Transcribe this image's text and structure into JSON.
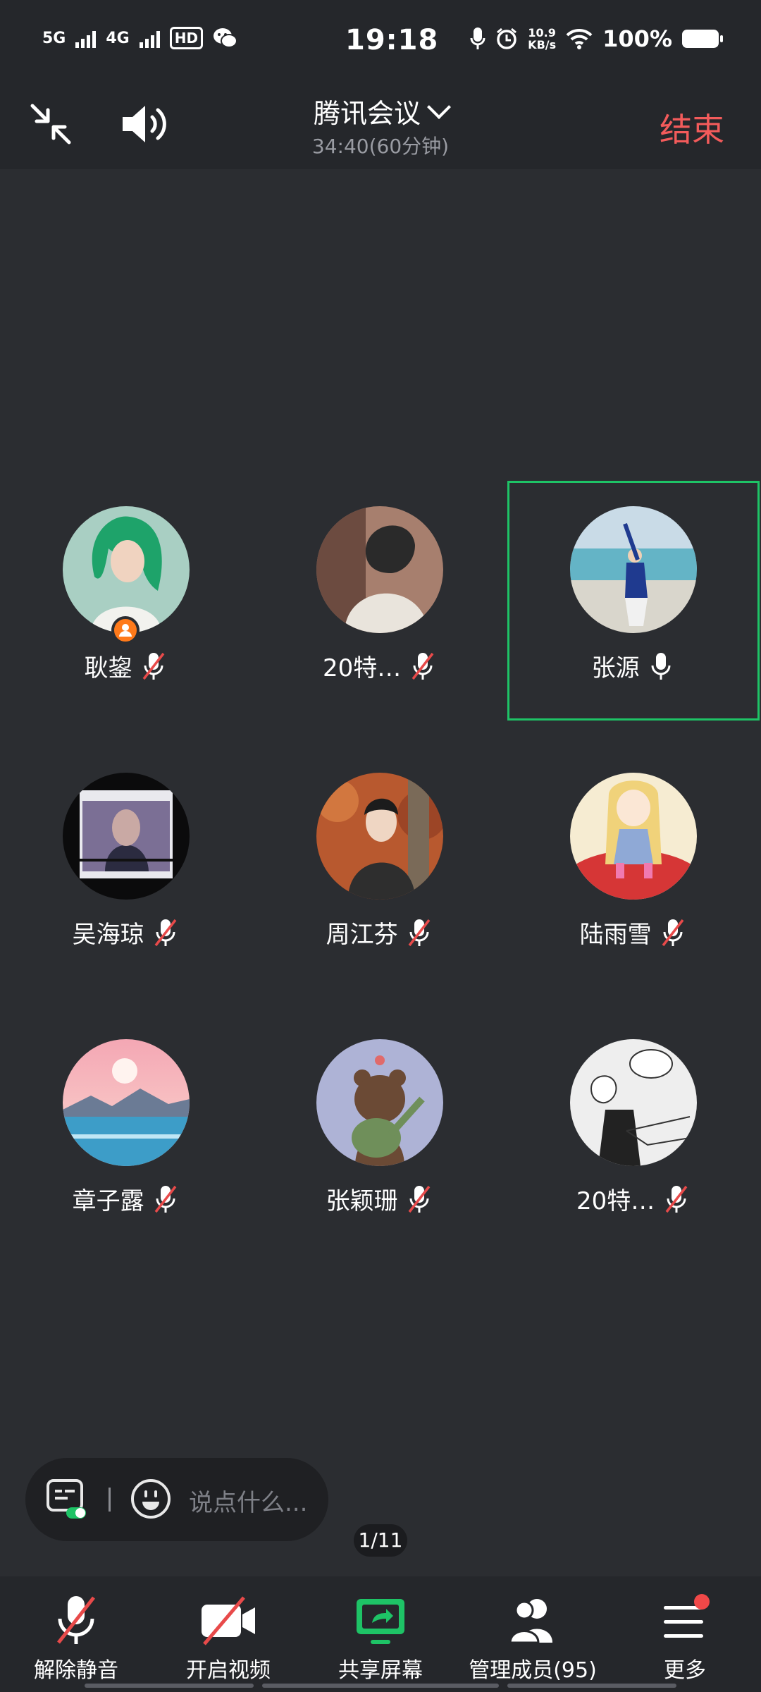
{
  "status_bar": {
    "network1": "5G",
    "network2": "4G",
    "hd": "HD",
    "time": "19:18",
    "speed_value": "10.9",
    "speed_unit": "KB/s",
    "battery": "100%"
  },
  "header": {
    "title": "腾讯会议",
    "subtitle": "34:40(60分钟)",
    "end_label": "结束"
  },
  "participants": [
    {
      "name": "耿鋆",
      "mic": "muted",
      "host": true
    },
    {
      "name": "20特…",
      "mic": "muted"
    },
    {
      "name": "张源",
      "mic": "on",
      "speaking": true
    },
    {
      "name": "吴海琼",
      "mic": "muted"
    },
    {
      "name": "周江芬",
      "mic": "muted"
    },
    {
      "name": "陆雨雪",
      "mic": "muted"
    },
    {
      "name": "章子露",
      "mic": "muted"
    },
    {
      "name": "张颖珊",
      "mic": "muted"
    },
    {
      "name": "20特…",
      "mic": "muted"
    }
  ],
  "chat": {
    "placeholder": "说点什么..."
  },
  "pager": "1/11",
  "toolbar": {
    "unmute": "解除静音",
    "video": "开启视频",
    "share": "共享屏幕",
    "members": "管理成员(95)",
    "more": "更多"
  },
  "colors": {
    "background": "#2b2d31",
    "bar": "#25272b",
    "accent_green": "#1ec366",
    "end_red": "#f35b5b",
    "mute_red": "#e84a4a"
  }
}
